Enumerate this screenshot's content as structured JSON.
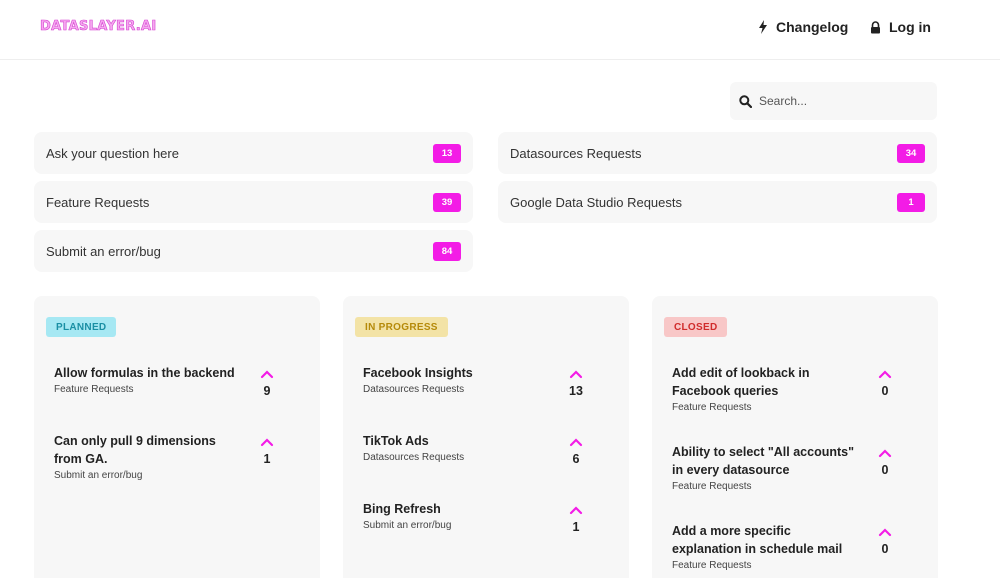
{
  "header": {
    "logo": "DATASLAYER.AI",
    "changelog": "Changelog",
    "login": "Log in"
  },
  "search": {
    "placeholder": "Search..."
  },
  "categories": [
    {
      "label": "Ask your question here",
      "count": "13"
    },
    {
      "label": "Datasources Requests",
      "count": "34"
    },
    {
      "label": "Feature Requests",
      "count": "39"
    },
    {
      "label": "Google Data Studio Requests",
      "count": "1"
    },
    {
      "label": "Submit an error/bug",
      "count": "84"
    }
  ],
  "colors": {
    "accent": "#f31ce6",
    "planned_bg": "#a6e8f3",
    "planned_fg": "#1a8fa4",
    "inprogress_bg": "#f3e3a6",
    "inprogress_fg": "#b58a0a",
    "closed_bg": "#f8c7c7",
    "closed_fg": "#d02b2b"
  },
  "columns": [
    {
      "status": "PLANNED",
      "items": [
        {
          "title": "Allow formulas in the backend",
          "category": "Feature Requests",
          "votes": "9"
        },
        {
          "title": "Can only pull 9 dimensions from GA.",
          "category": "Submit an error/bug",
          "votes": "1"
        }
      ]
    },
    {
      "status": "IN PROGRESS",
      "items": [
        {
          "title": "Facebook Insights",
          "category": "Datasources Requests",
          "votes": "13"
        },
        {
          "title": "TikTok Ads",
          "category": "Datasources Requests",
          "votes": "6"
        },
        {
          "title": "Bing Refresh",
          "category": "Submit an error/bug",
          "votes": "1"
        }
      ]
    },
    {
      "status": "CLOSED",
      "items": [
        {
          "title": "Add edit of lookback in Facebook queries",
          "category": "Feature Requests",
          "votes": "0"
        },
        {
          "title": "Ability to select \"All accounts\" in every datasource",
          "category": "Feature Requests",
          "votes": "0"
        },
        {
          "title": "Add a more specific explanation in schedule mail",
          "category": "Feature Requests",
          "votes": "0"
        }
      ]
    }
  ]
}
